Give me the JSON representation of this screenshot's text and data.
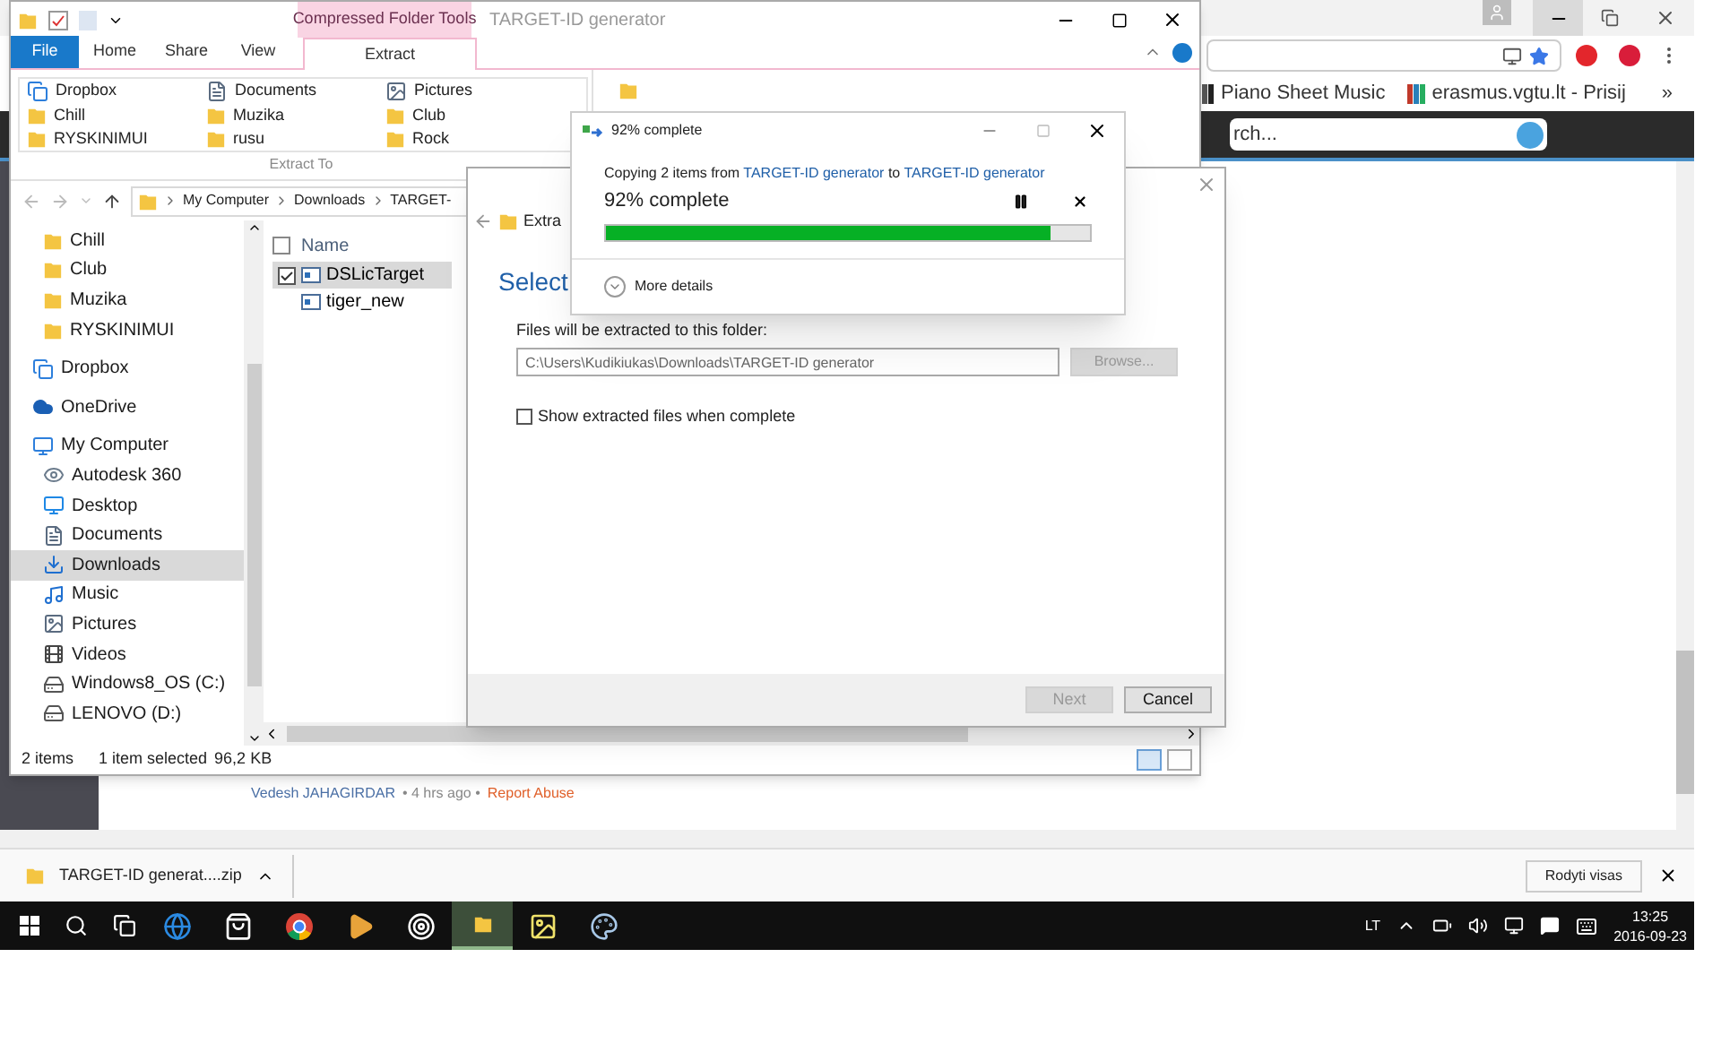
{
  "browser": {
    "bookmarks": [
      {
        "label": "Piano Sheet Music"
      },
      {
        "label": "erasmus.vgtu.lt - Prisij"
      }
    ],
    "more": "»",
    "search": {
      "placeholder": "rch..."
    },
    "comment": {
      "author": "Vedesh JAHAGIRDAR",
      "meta": "• 4 hrs ago •",
      "action": "Report Abuse"
    }
  },
  "explorer": {
    "context_tab": "Compressed Folder Tools",
    "title": "TARGET-ID generator",
    "ribbon_tabs": [
      {
        "label": "File",
        "kind": "file",
        "selected": false
      },
      {
        "label": "Home",
        "kind": "tab",
        "selected": false
      },
      {
        "label": "Share",
        "kind": "tab",
        "selected": false
      },
      {
        "label": "View",
        "kind": "tab",
        "selected": false
      },
      {
        "label": "Extract",
        "kind": "tab",
        "selected": true
      }
    ],
    "extract_to": [
      {
        "label": "Dropbox",
        "kind": "dropbox"
      },
      {
        "label": "Documents",
        "kind": "document"
      },
      {
        "label": "Pictures",
        "kind": "picture"
      },
      {
        "label": "Chill",
        "kind": "folder"
      },
      {
        "label": "Muzika",
        "kind": "folder"
      },
      {
        "label": "Club",
        "kind": "folder"
      },
      {
        "label": "RYSKINIMUI",
        "kind": "folder"
      },
      {
        "label": "rusu",
        "kind": "folder"
      },
      {
        "label": "Rock",
        "kind": "folder"
      }
    ],
    "group_label": "Extract To",
    "breadcrumb": [
      "My Computer",
      "Downloads",
      "TARGET-"
    ],
    "quick_access": [
      {
        "label": "Chill",
        "kind": "folder",
        "selected": false
      },
      {
        "label": "Club",
        "kind": "folder",
        "selected": false
      },
      {
        "label": "Muzika",
        "kind": "folder",
        "selected": false
      },
      {
        "label": "RYSKINIMUI",
        "kind": "folder",
        "selected": false
      }
    ],
    "nav": [
      {
        "label": "Dropbox",
        "kind": "dropbox",
        "selected": false
      },
      {
        "label": "OneDrive",
        "kind": "cloud",
        "selected": false
      },
      {
        "label": "My Computer",
        "kind": "computer",
        "selected": false,
        "children": [
          {
            "label": "Autodesk 360",
            "kind": "eye",
            "selected": false
          },
          {
            "label": "Desktop",
            "kind": "desktop",
            "selected": false
          },
          {
            "label": "Documents",
            "kind": "document",
            "selected": false
          },
          {
            "label": "Downloads",
            "kind": "download",
            "selected": true
          },
          {
            "label": "Music",
            "kind": "music",
            "selected": false
          },
          {
            "label": "Pictures",
            "kind": "picture",
            "selected": false
          },
          {
            "label": "Videos",
            "kind": "video",
            "selected": false
          },
          {
            "label": "Windows8_OS (C:)",
            "kind": "drive",
            "selected": false
          },
          {
            "label": "LENOVO (D:)",
            "kind": "drive",
            "selected": false
          }
        ]
      }
    ],
    "column_header": "Name",
    "select_all": {
      "checked": false
    },
    "files": [
      {
        "name": "DSLicTarget",
        "selected": true
      },
      {
        "name": "tiger_new",
        "selected": false
      }
    ],
    "status": {
      "count": "2 items",
      "selection": "1 item selected",
      "size": "96,2 KB"
    }
  },
  "wizard": {
    "heading": "Extra",
    "title": "Select",
    "folder_label": "Files will be extracted to this folder:",
    "path": "C:\\Users\\Kudikiukas\\Downloads\\TARGET-ID generator",
    "browse": {
      "label": "Browse...",
      "disabled": true
    },
    "show_files": {
      "label": "Show extracted files when complete",
      "checked": false
    },
    "buttons": [
      {
        "label": "Next",
        "disabled": true
      },
      {
        "label": "Cancel",
        "disabled": false
      }
    ]
  },
  "copy_dialog": {
    "title": "92% complete",
    "prefix": "Copying 2 items from",
    "source": "TARGET-ID generator",
    "joiner": "to",
    "destination": "TARGET-ID generator",
    "status": "92% complete",
    "level": 0.92,
    "details": "More details"
  },
  "download_bar": {
    "file": "TARGET-ID generat....zip",
    "show_all": "Rodyti visas"
  },
  "taskbar": {
    "apps": [
      {
        "kind": "edge",
        "active": false
      },
      {
        "kind": "store",
        "active": false
      },
      {
        "kind": "chrome",
        "active": false
      },
      {
        "kind": "media",
        "active": false
      },
      {
        "kind": "target",
        "active": false
      },
      {
        "kind": "explorer",
        "active": true
      },
      {
        "kind": "photos",
        "active": false
      },
      {
        "kind": "paint",
        "active": false
      }
    ],
    "language": "LT",
    "time": "13:25",
    "date": "2016-09-23"
  }
}
